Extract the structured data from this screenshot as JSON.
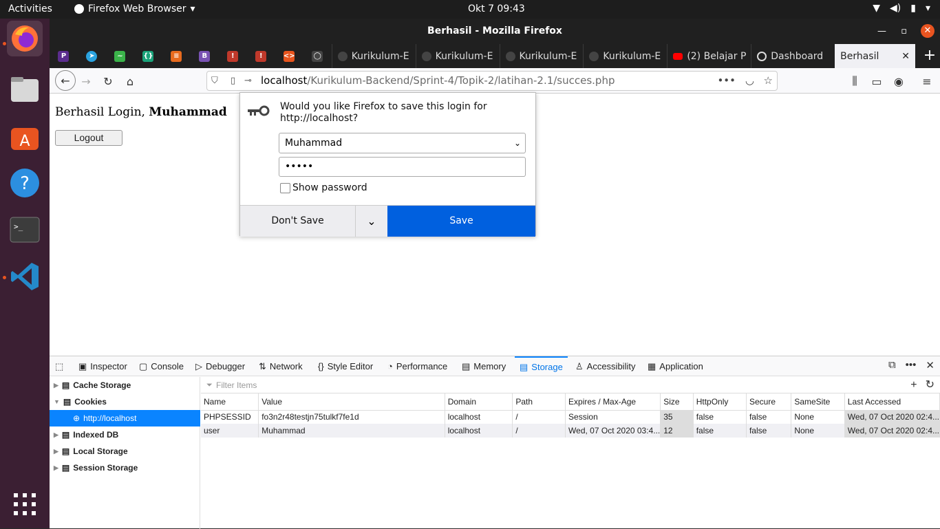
{
  "topbar": {
    "activities": "Activities",
    "app": "Firefox Web Browser",
    "clock": "Okt 7  09:43"
  },
  "window": {
    "title": "Berhasil - Mozilla Firefox"
  },
  "tabs": {
    "pinned": [
      {
        "letter": "P",
        "color": "#5b2d8e"
      },
      {
        "letter": "➤",
        "color": "#2aa3e0"
      },
      {
        "letter": "~",
        "color": "#3bb34a"
      },
      {
        "letter": "{}",
        "color": "#1aa37a"
      },
      {
        "letter": "≡",
        "color": "#e86b1e"
      },
      {
        "letter": "B",
        "color": "#7952b3"
      },
      {
        "letter": "!",
        "color": "#c0392b"
      },
      {
        "letter": "!",
        "color": "#c0392b"
      },
      {
        "letter": "<>",
        "color": "#e8541d"
      },
      {
        "letter": "◯",
        "color": "#444444"
      }
    ],
    "items": [
      {
        "label": "Kurikulum-E"
      },
      {
        "label": "Kurikulum-E"
      },
      {
        "label": "Kurikulum-E"
      },
      {
        "label": "Kurikulum-E"
      },
      {
        "label": "(2) Belajar P"
      },
      {
        "label": "Dashboard"
      }
    ],
    "selected": "Berhasil"
  },
  "url": {
    "host": "localhost",
    "path": "/Kurikulum-Backend/Sprint-4/Topik-2/latihan-2.1/succes.php"
  },
  "page": {
    "greeting": "Berhasil Login, ",
    "username": "Muhammad",
    "logout": "Logout"
  },
  "popup": {
    "question_line1": "Would you like Firefox to save this login for",
    "question_line2": "http://localhost?",
    "username": "Muhammad",
    "password": "•••••",
    "show_password": "Show password",
    "dont_save": "Don't Save",
    "save": "Save"
  },
  "devtools": {
    "tabs": [
      "Inspector",
      "Console",
      "Debugger",
      "Network",
      "Style Editor",
      "Performance",
      "Memory",
      "Storage",
      "Accessibility",
      "Application"
    ],
    "sidebar": [
      "Cache Storage",
      "Cookies",
      "http://localhost",
      "Indexed DB",
      "Local Storage",
      "Session Storage"
    ],
    "filter_placeholder": "Filter Items",
    "columns": [
      "Name",
      "Value",
      "Domain",
      "Path",
      "Expires / Max-Age",
      "Size",
      "HttpOnly",
      "Secure",
      "SameSite",
      "Last Accessed"
    ],
    "rows": [
      [
        "PHPSESSID",
        "fo3n2r48testjn75tulkf7fe1d",
        "localhost",
        "/",
        "Session",
        "35",
        "false",
        "false",
        "None",
        "Wed, 07 Oct 2020 02:4..."
      ],
      [
        "user",
        "Muhammad",
        "localhost",
        "/",
        "Wed, 07 Oct 2020 03:4...",
        "12",
        "false",
        "false",
        "None",
        "Wed, 07 Oct 2020 02:4..."
      ]
    ]
  },
  "colors": {
    "accent": "#0060df",
    "dock": "#3b1f33",
    "selection": "#0a84ff"
  }
}
